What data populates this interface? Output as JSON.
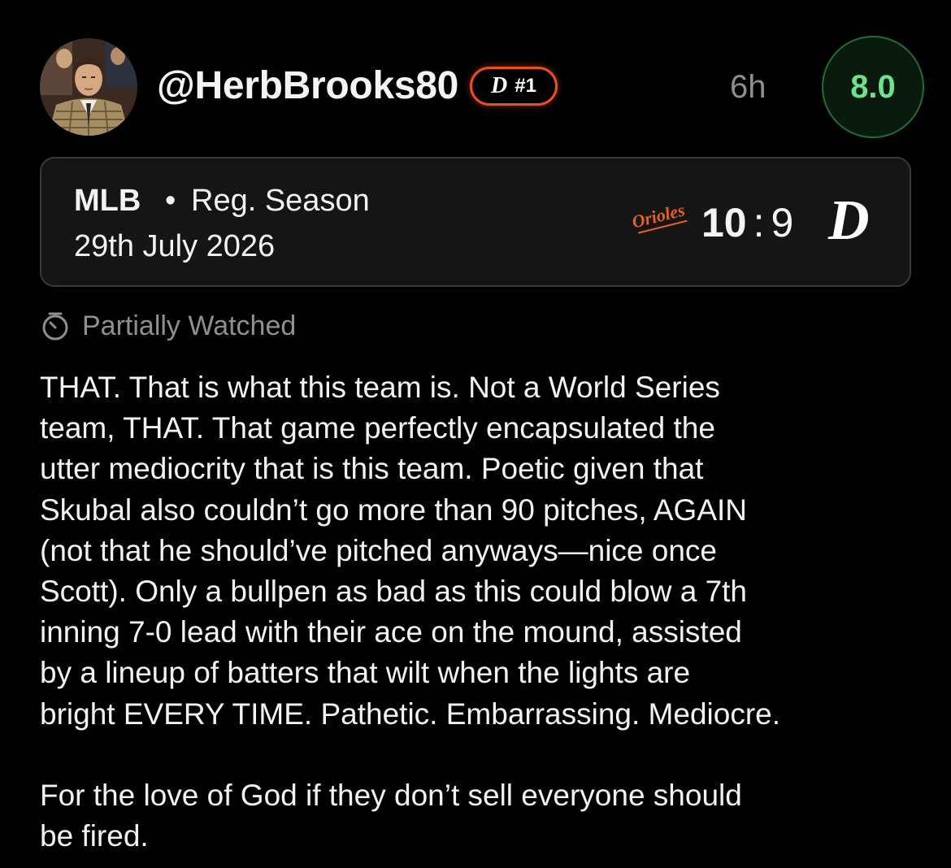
{
  "post": {
    "username": "@HerbBrooks80",
    "badge": {
      "team_icon": "tigers-old-english-d-icon",
      "rank": "#1"
    },
    "time_ago": "6h",
    "rating": "8.0"
  },
  "game": {
    "league": "MLB",
    "separator": "•",
    "season_type": "Reg. Season",
    "date": "29th July 2026",
    "away_team_logo_text": "Orioles",
    "away_score": "10",
    "score_separator": ":",
    "home_score": "9",
    "home_team_icon": "tigers-old-english-d-icon"
  },
  "watch_status": {
    "icon": "stopwatch-icon",
    "label": "Partially Watched"
  },
  "review": {
    "lines": [
      "THAT. That is what this team is. Not a World Series",
      "team, THAT. That game perfectly encapsulated the",
      "utter mediocrity that is this team. Poetic given that",
      "Skubal also couldn’t go more than 90 pitches, AGAIN",
      "(not that he should’ve pitched anyways—nice once",
      "Scott). Only a bullpen as bad as this could blow a 7th",
      "inning 7-0 lead with their ace on the mound, assisted",
      "by a lineup of batters that wilt when the lights are",
      "bright EVERY TIME. Pathetic. Embarrassing. Mediocre.",
      "",
      "For the love of God if they don’t sell everyone should",
      "be fired."
    ]
  },
  "colors": {
    "background": "#000000",
    "card_background": "#151516",
    "card_border": "#3a3a3c",
    "badge_border": "#e8501f",
    "rating_text": "#6ee28a",
    "rating_border": "#1f6e35",
    "muted_text": "#8e8e93",
    "orioles_orange": "#e8611a"
  }
}
